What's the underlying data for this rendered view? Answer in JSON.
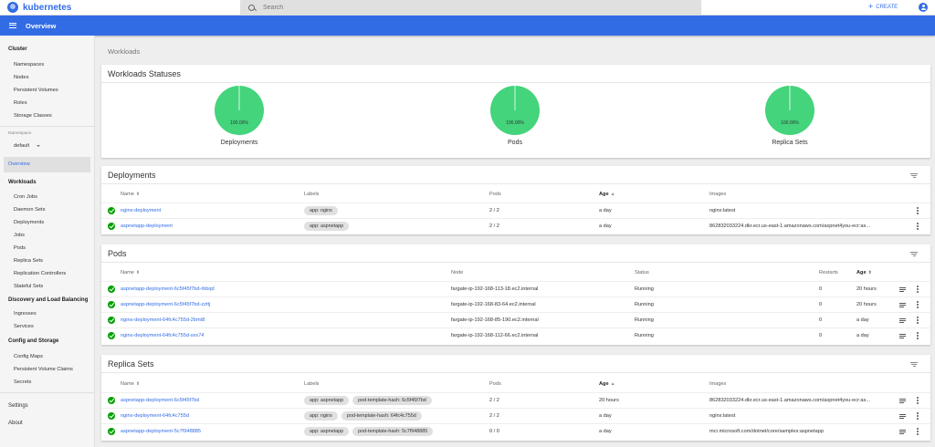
{
  "app": {
    "brand": "kubernetes",
    "title": "Overview"
  },
  "search": {
    "placeholder": "Search"
  },
  "actions": {
    "create_label": "CREATE"
  },
  "sidebar": {
    "cluster": "Cluster",
    "cluster_items": [
      "Namespaces",
      "Nodes",
      "Persistent Volumes",
      "Roles",
      "Storage Classes"
    ],
    "namespace_label": "Namespace",
    "namespace_value": "default",
    "overview": "Overview",
    "workloads": "Workloads",
    "workload_items": [
      "Cron Jobs",
      "Daemon Sets",
      "Deployments",
      "Jobs",
      "Pods",
      "Replica Sets",
      "Replication Controllers",
      "Stateful Sets"
    ],
    "discovery": "Discovery and Load Balancing",
    "discovery_items": [
      "Ingresses",
      "Services"
    ],
    "config": "Config and Storage",
    "config_items": [
      "Config Maps",
      "Persistent Volume Claims",
      "Secrets"
    ],
    "settings": "Settings",
    "about": "About"
  },
  "breadcrumb": "Workloads",
  "statuses": {
    "title": "Workloads Statuses",
    "items": [
      {
        "label": "Deployments",
        "percent": "100.00%",
        "value": 100
      },
      {
        "label": "Pods",
        "percent": "100.00%",
        "value": 100
      },
      {
        "label": "Replica Sets",
        "percent": "100.00%",
        "value": 100
      }
    ],
    "color": "#43d47c"
  },
  "deployments": {
    "title": "Deployments",
    "headers": {
      "name": "Name",
      "labels": "Labels",
      "pods": "Pods",
      "age": "Age",
      "images": "Images"
    },
    "rows": [
      {
        "name": "nginx-deployment",
        "labels": [
          "app: nginx"
        ],
        "pods": "2 / 2",
        "age": "a day",
        "images": "nginx:latest"
      },
      {
        "name": "aspnetapp-deployment",
        "labels": [
          "app: aspnetapp"
        ],
        "pods": "2 / 2",
        "age": "a day",
        "images": "862832033224.dkr.ecr.us-east-1.amazonaws.com/aspnet4you-ecr:as..."
      }
    ]
  },
  "pods": {
    "title": "Pods",
    "headers": {
      "name": "Name",
      "node": "Node",
      "status": "Status",
      "restarts": "Restarts",
      "age": "Age"
    },
    "rows": [
      {
        "name": "aspnetapp-deployment-6c5f45f7bd-rbbqd",
        "node": "fargate-ip-192-168-113-18.ec2.internal",
        "status": "Running",
        "restarts": "0",
        "age": "20 hours"
      },
      {
        "name": "aspnetapp-deployment-6c5f45f7bd-zzttj",
        "node": "fargate-ip-192-168-83-64.ec2.internal",
        "status": "Running",
        "restarts": "0",
        "age": "20 hours"
      },
      {
        "name": "nginx-deployment-64fc4c755d-2bmt8",
        "node": "fargate-ip-192-168-85-190.ec2.internal",
        "status": "Running",
        "restarts": "0",
        "age": "a day"
      },
      {
        "name": "nginx-deployment-64fc4c755d-sxx74",
        "node": "fargate-ip-192-168-112-66.ec2.internal",
        "status": "Running",
        "restarts": "0",
        "age": "a day"
      }
    ]
  },
  "replicasets": {
    "title": "Replica Sets",
    "headers": {
      "name": "Name",
      "labels": "Labels",
      "pods": "Pods",
      "age": "Age",
      "images": "Images"
    },
    "rows": [
      {
        "name": "aspnetapp-deployment-6c5f45f7bd",
        "labels": [
          "app: aspnetapp",
          "pod-template-hash: 6c5f45f7bd"
        ],
        "pods": "2 / 2",
        "age": "20 hours",
        "images": "862832033224.dkr.ecr.us-east-1.amazonaws.com/aspnet4you-ecr:as..."
      },
      {
        "name": "nginx-deployment-64fc4c755d",
        "labels": [
          "app: nginx",
          "pod-template-hash: 64fc4c755d"
        ],
        "pods": "2 / 2",
        "age": "a day",
        "images": "nginx:latest"
      },
      {
        "name": "aspnetapp-deployment-5c7f948885",
        "labels": [
          "app: aspnetapp",
          "pod-template-hash: 5c7f948885"
        ],
        "pods": "0 / 0",
        "age": "a day",
        "images": "mcr.microsoft.com/dotnet/core/samples:aspnetapp"
      }
    ]
  },
  "colors": {
    "accent": "#326ce5",
    "ok": "#00a000"
  }
}
